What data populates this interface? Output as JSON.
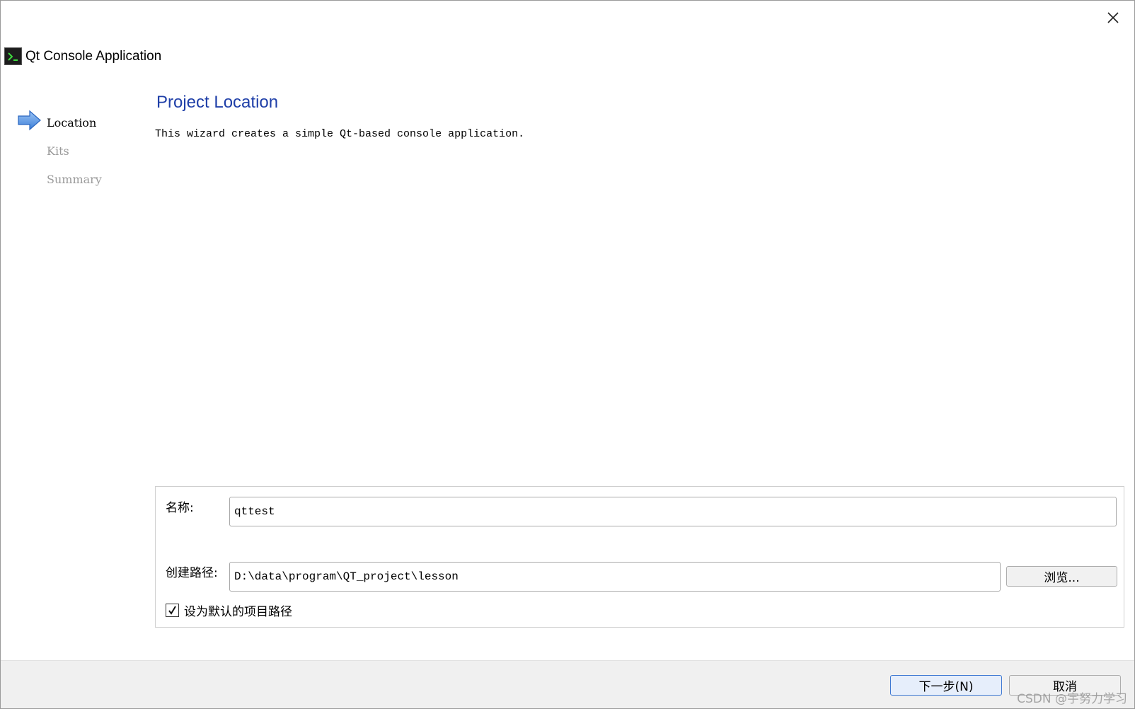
{
  "window": {
    "title": "Qt Console Application"
  },
  "steps": [
    {
      "label": "Location",
      "current": true
    },
    {
      "label": "Kits",
      "current": false
    },
    {
      "label": "Summary",
      "current": false
    }
  ],
  "page": {
    "title": "Project Location",
    "subtitle": "This wizard creates a simple Qt-based console application."
  },
  "form": {
    "name_label": "名称:",
    "name_value": "qttest",
    "path_label": "创建路径:",
    "path_value": "D:\\data\\program\\QT_project\\lesson",
    "browse_label": "浏览...",
    "default_path_checked": true,
    "default_path_label": "设为默认的项目路径"
  },
  "footer": {
    "next_label": "下一步(N)",
    "cancel_label": "取消"
  },
  "watermark": "CSDN @宇努力学习",
  "icons": {
    "close": "close-icon",
    "app": "console-app-icon",
    "current_step": "arrow-right-icon"
  },
  "colors": {
    "title_blue": "#1f3fa8",
    "inactive_step": "#9a9a9a",
    "next_button_border": "#3d78d2"
  }
}
